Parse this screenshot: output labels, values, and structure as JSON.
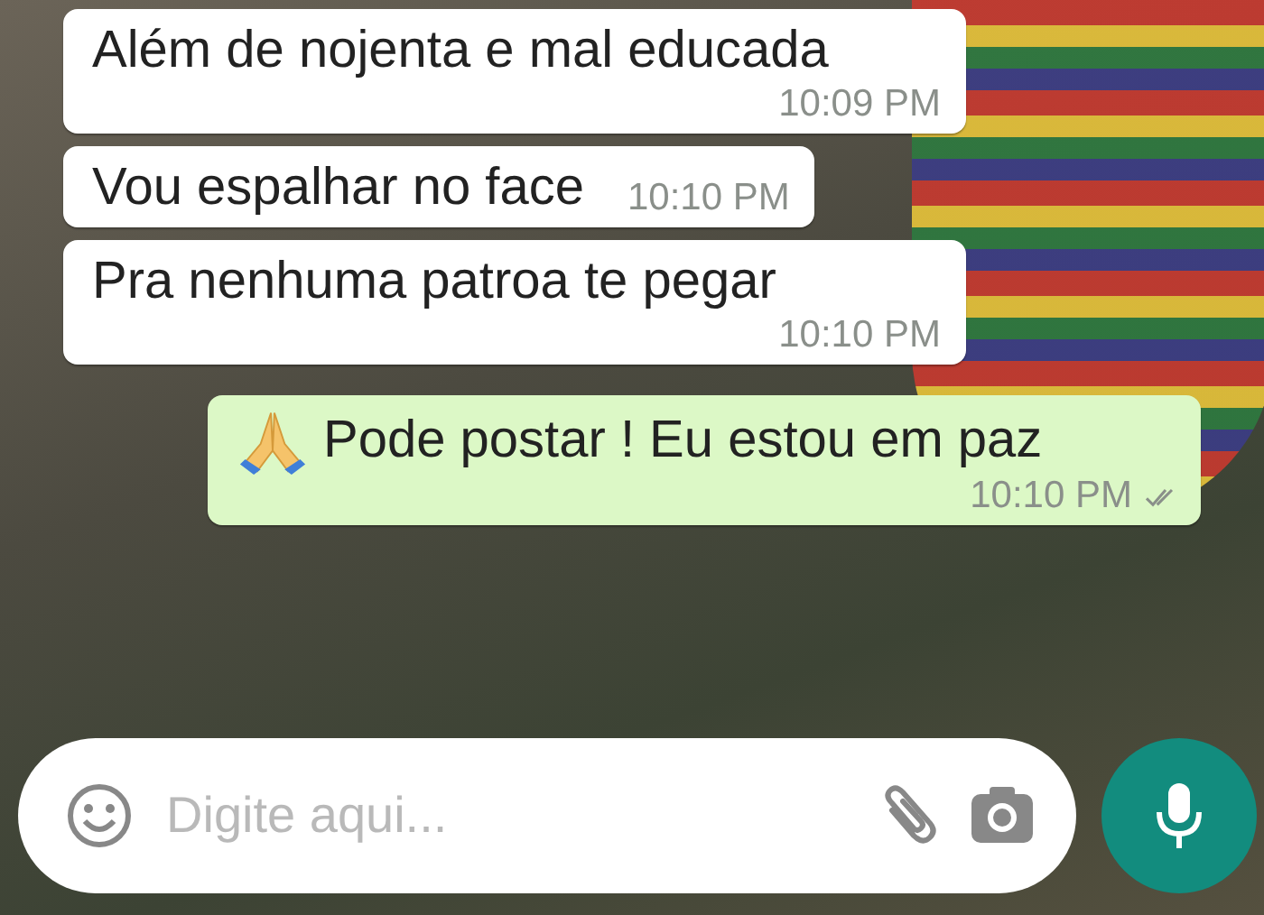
{
  "messages": [
    {
      "kind": "incoming",
      "text": "Além de nojenta e mal educada",
      "time": "10:09 PM"
    },
    {
      "kind": "incoming",
      "text": "Vou espalhar no face",
      "time": "10:10 PM"
    },
    {
      "kind": "incoming",
      "text": "Pra nenhuma patroa te pegar",
      "time": "10:10 PM"
    },
    {
      "kind": "outgoing",
      "text": "Pode postar ! Eu estou em paz",
      "time": "10:10 PM",
      "read": false
    }
  ],
  "composer": {
    "placeholder": "Digite aqui..."
  }
}
